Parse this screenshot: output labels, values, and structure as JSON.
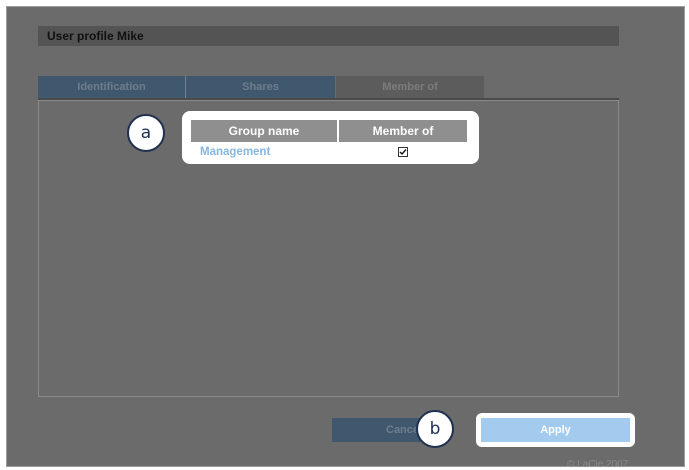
{
  "header": {
    "title": "User profile Mike"
  },
  "tabs": [
    {
      "label": "Identification"
    },
    {
      "label": "Shares"
    },
    {
      "label": "Member of"
    }
  ],
  "table": {
    "columns": [
      "Group name",
      "Member of"
    ],
    "rows": [
      {
        "group": "Management",
        "member": true
      }
    ]
  },
  "callouts": {
    "a": "a",
    "b": "b"
  },
  "buttons": {
    "cancel": "Cancel",
    "apply": "Apply"
  },
  "footer": {
    "copyright": "© LaCie 2007"
  },
  "colors": {
    "tab_active": "#3f586e",
    "link": "#86b7e0",
    "apply": "#a3cbee"
  }
}
